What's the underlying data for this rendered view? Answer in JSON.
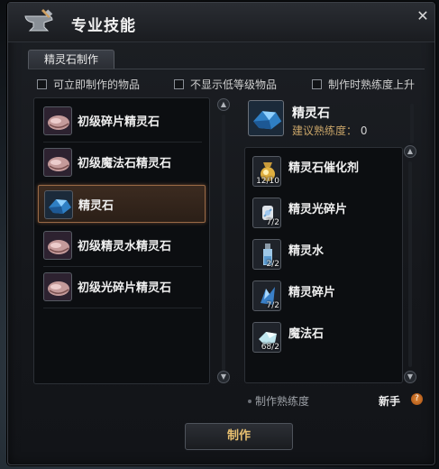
{
  "window": {
    "title": "专业技能",
    "close_symbol": "✕"
  },
  "tab": {
    "label": "精灵石制作"
  },
  "filters": [
    {
      "label": "可立即制作的物品",
      "checked": false
    },
    {
      "label": "不显示低等级物品",
      "checked": false
    },
    {
      "label": "制作时熟练度上升",
      "checked": false
    }
  ],
  "recipes": [
    {
      "label": "初级碎片精灵石",
      "icon": "gem-pink-icon",
      "selected": false
    },
    {
      "label": "初级魔法石精灵石",
      "icon": "gem-pink-icon",
      "selected": false
    },
    {
      "label": "精灵石",
      "icon": "gem-blue-icon",
      "selected": true
    },
    {
      "label": "初级精灵水精灵石",
      "icon": "gem-pink-icon",
      "selected": false
    },
    {
      "label": "初级光碎片精灵石",
      "icon": "gem-pink-icon",
      "selected": false
    }
  ],
  "detail": {
    "name": "精灵石",
    "proficiency_label": "建议熟练度：",
    "proficiency_value": "0",
    "icon": "gem-blue-icon"
  },
  "materials": [
    {
      "label": "精灵石催化剂",
      "qty": "12/10",
      "icon": "catalyst-icon"
    },
    {
      "label": "精灵光碎片",
      "qty": "7/2",
      "icon": "light-shard-icon"
    },
    {
      "label": "精灵水",
      "qty": "2/2",
      "icon": "spirit-water-icon"
    },
    {
      "label": "精灵碎片",
      "qty": "7/2",
      "icon": "spirit-shard-icon"
    },
    {
      "label": "魔法石",
      "qty": "68/2",
      "icon": "magic-stone-icon"
    }
  ],
  "footer": {
    "proficiency_label": "制作熟练度",
    "rank": "新手",
    "help_symbol": "?"
  },
  "craft_button": {
    "label": "制作"
  },
  "colors": {
    "accent_gold": "#c8a468",
    "selected_border": "#9a6a46",
    "craft_text": "#e8c070"
  }
}
